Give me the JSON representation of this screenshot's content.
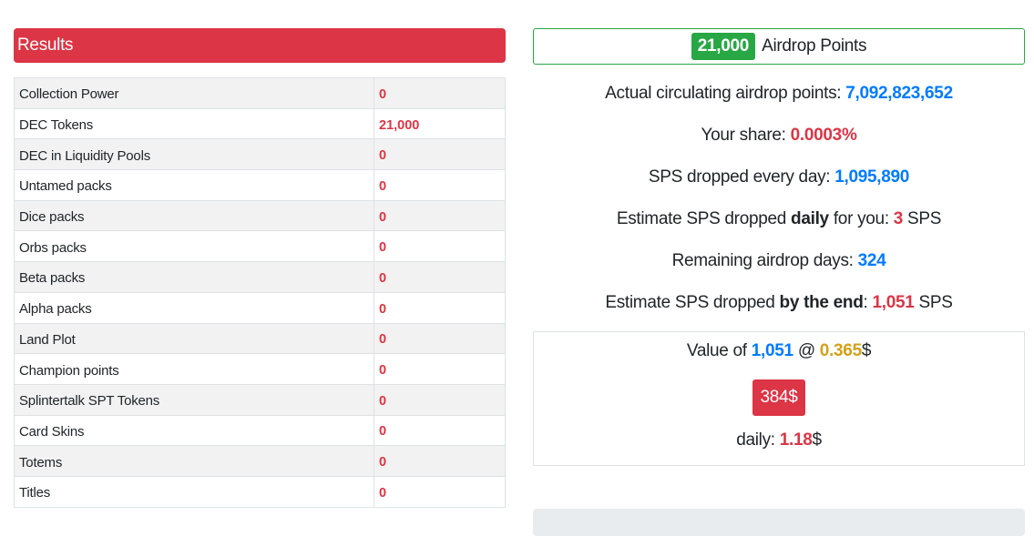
{
  "results": {
    "header": "Results",
    "rows": [
      {
        "label": "Collection Power",
        "value": "0"
      },
      {
        "label": "DEC Tokens",
        "value": "21,000"
      },
      {
        "label": "DEC in Liquidity Pools",
        "value": "0"
      },
      {
        "label": "Untamed packs",
        "value": "0"
      },
      {
        "label": "Dice packs",
        "value": "0"
      },
      {
        "label": "Orbs packs",
        "value": "0"
      },
      {
        "label": "Beta packs",
        "value": "0"
      },
      {
        "label": "Alpha packs",
        "value": "0"
      },
      {
        "label": "Land Plot",
        "value": "0"
      },
      {
        "label": "Champion points",
        "value": "0"
      },
      {
        "label": "Splintertalk SPT Tokens",
        "value": "0"
      },
      {
        "label": "Card Skins",
        "value": "0"
      },
      {
        "label": "Totems",
        "value": "0"
      },
      {
        "label": "Titles",
        "value": "0"
      }
    ]
  },
  "airdrop": {
    "points_value": "21,000",
    "points_label": "Airdrop Points",
    "circulating_label": "Actual circulating airdrop points:",
    "circulating_value": "7,092,823,652",
    "share_label": "Your share:",
    "share_value": "0.0003%",
    "sps_daily_label": "SPS dropped every day:",
    "sps_daily_value": "1,095,890",
    "estimate_daily_prefix": "Estimate SPS dropped",
    "estimate_daily_bold": "daily",
    "estimate_daily_mid": "for you:",
    "estimate_daily_value": "3",
    "estimate_daily_unit": "SPS",
    "remaining_label": "Remaining airdrop days:",
    "remaining_value": "324",
    "estimate_end_prefix": "Estimate SPS dropped",
    "estimate_end_bold": "by the end",
    "estimate_end_colon": ":",
    "estimate_end_value": "1,051",
    "estimate_end_unit": "SPS"
  },
  "value_box": {
    "prefix": "Value of",
    "amount": "1,051",
    "at": "@",
    "price": "0.365",
    "currency": "$",
    "usd_total": "384$",
    "daily_label": "daily:",
    "daily_value": "1.18",
    "daily_currency": "$"
  },
  "colors": {
    "danger": "#dc3545",
    "success": "#28a745",
    "primary": "#007bff",
    "warning": "#d4a017"
  }
}
